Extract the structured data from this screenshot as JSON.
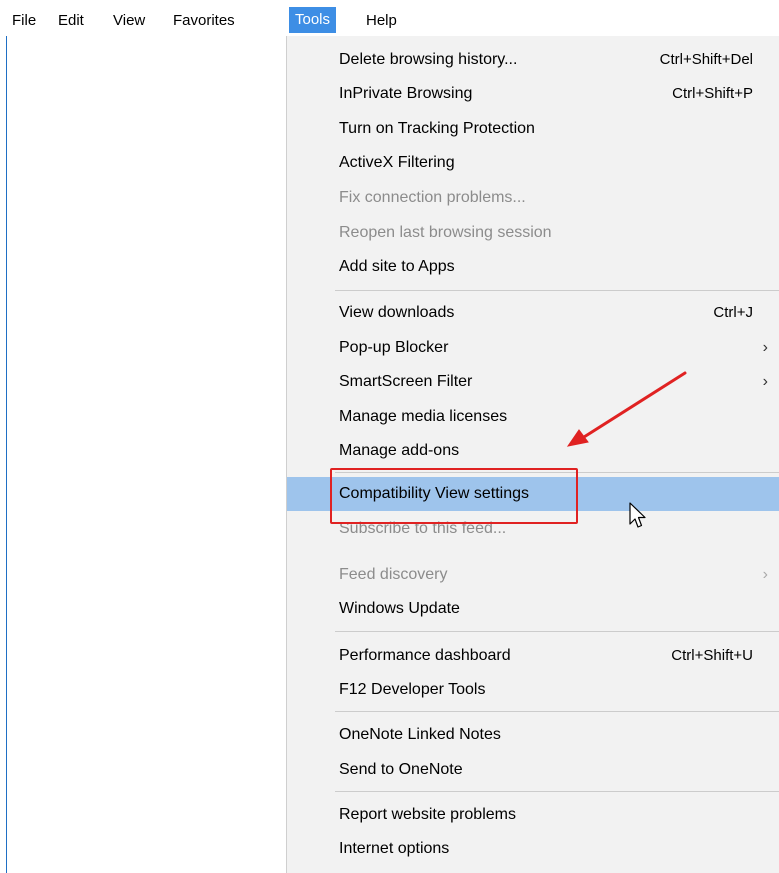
{
  "menubar": {
    "items": [
      {
        "label": "File"
      },
      {
        "label": "Edit"
      },
      {
        "label": "View"
      },
      {
        "label": "Favorites"
      },
      {
        "label": "Tools"
      },
      {
        "label": "Help"
      }
    ]
  },
  "tools_menu": {
    "items": [
      {
        "label": "Delete browsing history...",
        "shortcut": "Ctrl+Shift+Del"
      },
      {
        "label": "InPrivate Browsing",
        "shortcut": "Ctrl+Shift+P"
      },
      {
        "label": "Turn on Tracking Protection"
      },
      {
        "label": "ActiveX Filtering"
      },
      {
        "label": "Fix connection problems..."
      },
      {
        "label": "Reopen last browsing session"
      },
      {
        "label": "Add site to Apps"
      },
      {
        "label": "View downloads",
        "shortcut": "Ctrl+J"
      },
      {
        "label": "Pop-up Blocker",
        "submenu": "›"
      },
      {
        "label": "SmartScreen Filter",
        "submenu": "›"
      },
      {
        "label": "Manage media licenses"
      },
      {
        "label": "Manage add-ons"
      },
      {
        "label": "Compatibility View settings"
      },
      {
        "label": "Subscribe to this feed..."
      },
      {
        "label": "Feed discovery",
        "submenu": "›"
      },
      {
        "label": "Windows Update"
      },
      {
        "label": "Performance dashboard",
        "shortcut": "Ctrl+Shift+U"
      },
      {
        "label": "F12 Developer Tools"
      },
      {
        "label": "OneNote Linked Notes"
      },
      {
        "label": "Send to OneNote"
      },
      {
        "label": "Report website problems"
      },
      {
        "label": "Internet options"
      }
    ]
  },
  "colors": {
    "menu_active": "#3d8ee5",
    "item_highlight": "#9ec4ec",
    "annotation": "#e02222",
    "disabled_text": "#8c8c8c"
  }
}
